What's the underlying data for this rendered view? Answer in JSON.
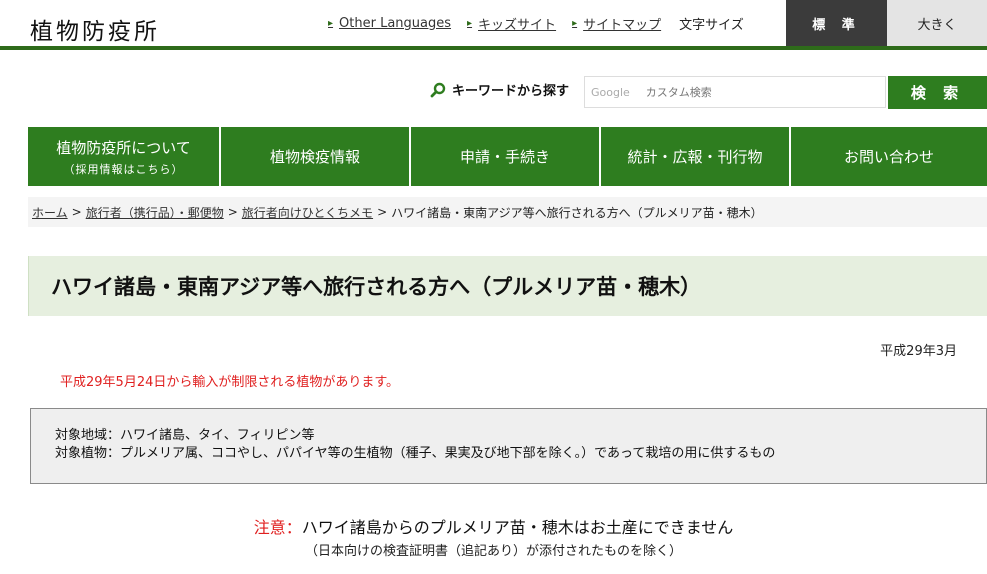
{
  "header": {
    "site_title": "植物防疫所",
    "links": [
      "Other Languages",
      "キッズサイト",
      "サイトマップ"
    ],
    "font_size_label": "文字サイズ",
    "font_size_standard": "標 準",
    "font_size_large": "大きく"
  },
  "search": {
    "label": "キーワードから探す",
    "input_brand": "Google",
    "input_placeholder": "カスタム検索",
    "button": "検 索"
  },
  "nav": {
    "items": [
      {
        "label": "植物防疫所について",
        "sub": "（採用情報はこちら）"
      },
      {
        "label": "植物検疫情報",
        "sub": ""
      },
      {
        "label": "申請・手続き",
        "sub": ""
      },
      {
        "label": "統計・広報・刊行物",
        "sub": ""
      },
      {
        "label": "お問い合わせ",
        "sub": ""
      }
    ]
  },
  "breadcrumb": {
    "links": [
      "ホーム",
      "旅行者（携行品）・郵便物",
      "旅行者向けひとくちメモ"
    ],
    "separator": ">",
    "current": "ハワイ諸島・東南アジア等へ旅行される方へ（プルメリア苗・穂木）"
  },
  "main": {
    "title": "ハワイ諸島・東南アジア等へ旅行される方へ（プルメリア苗・穂木）",
    "date": "平成29年3月",
    "notice": "平成29年5月24日から輸入が制限される植物があります。",
    "info_lines": [
      "対象地域：ハワイ諸島、タイ、フィリピン等",
      "対象植物：プルメリア属、ココやし、パパイヤ等の生植物（種子、果実及び地下部を除く。）であって栽培の用に供するもの"
    ],
    "caution_label": "注意：",
    "caution_text": "ハワイ諸島からのプルメリア苗・穂木はお土産にできません",
    "caution_sub": "（日本向けの検査証明書（追記あり）が添付されたものを除く）"
  },
  "colors": {
    "brand_green": "#2e7d1f",
    "alert_red": "#e02020"
  }
}
